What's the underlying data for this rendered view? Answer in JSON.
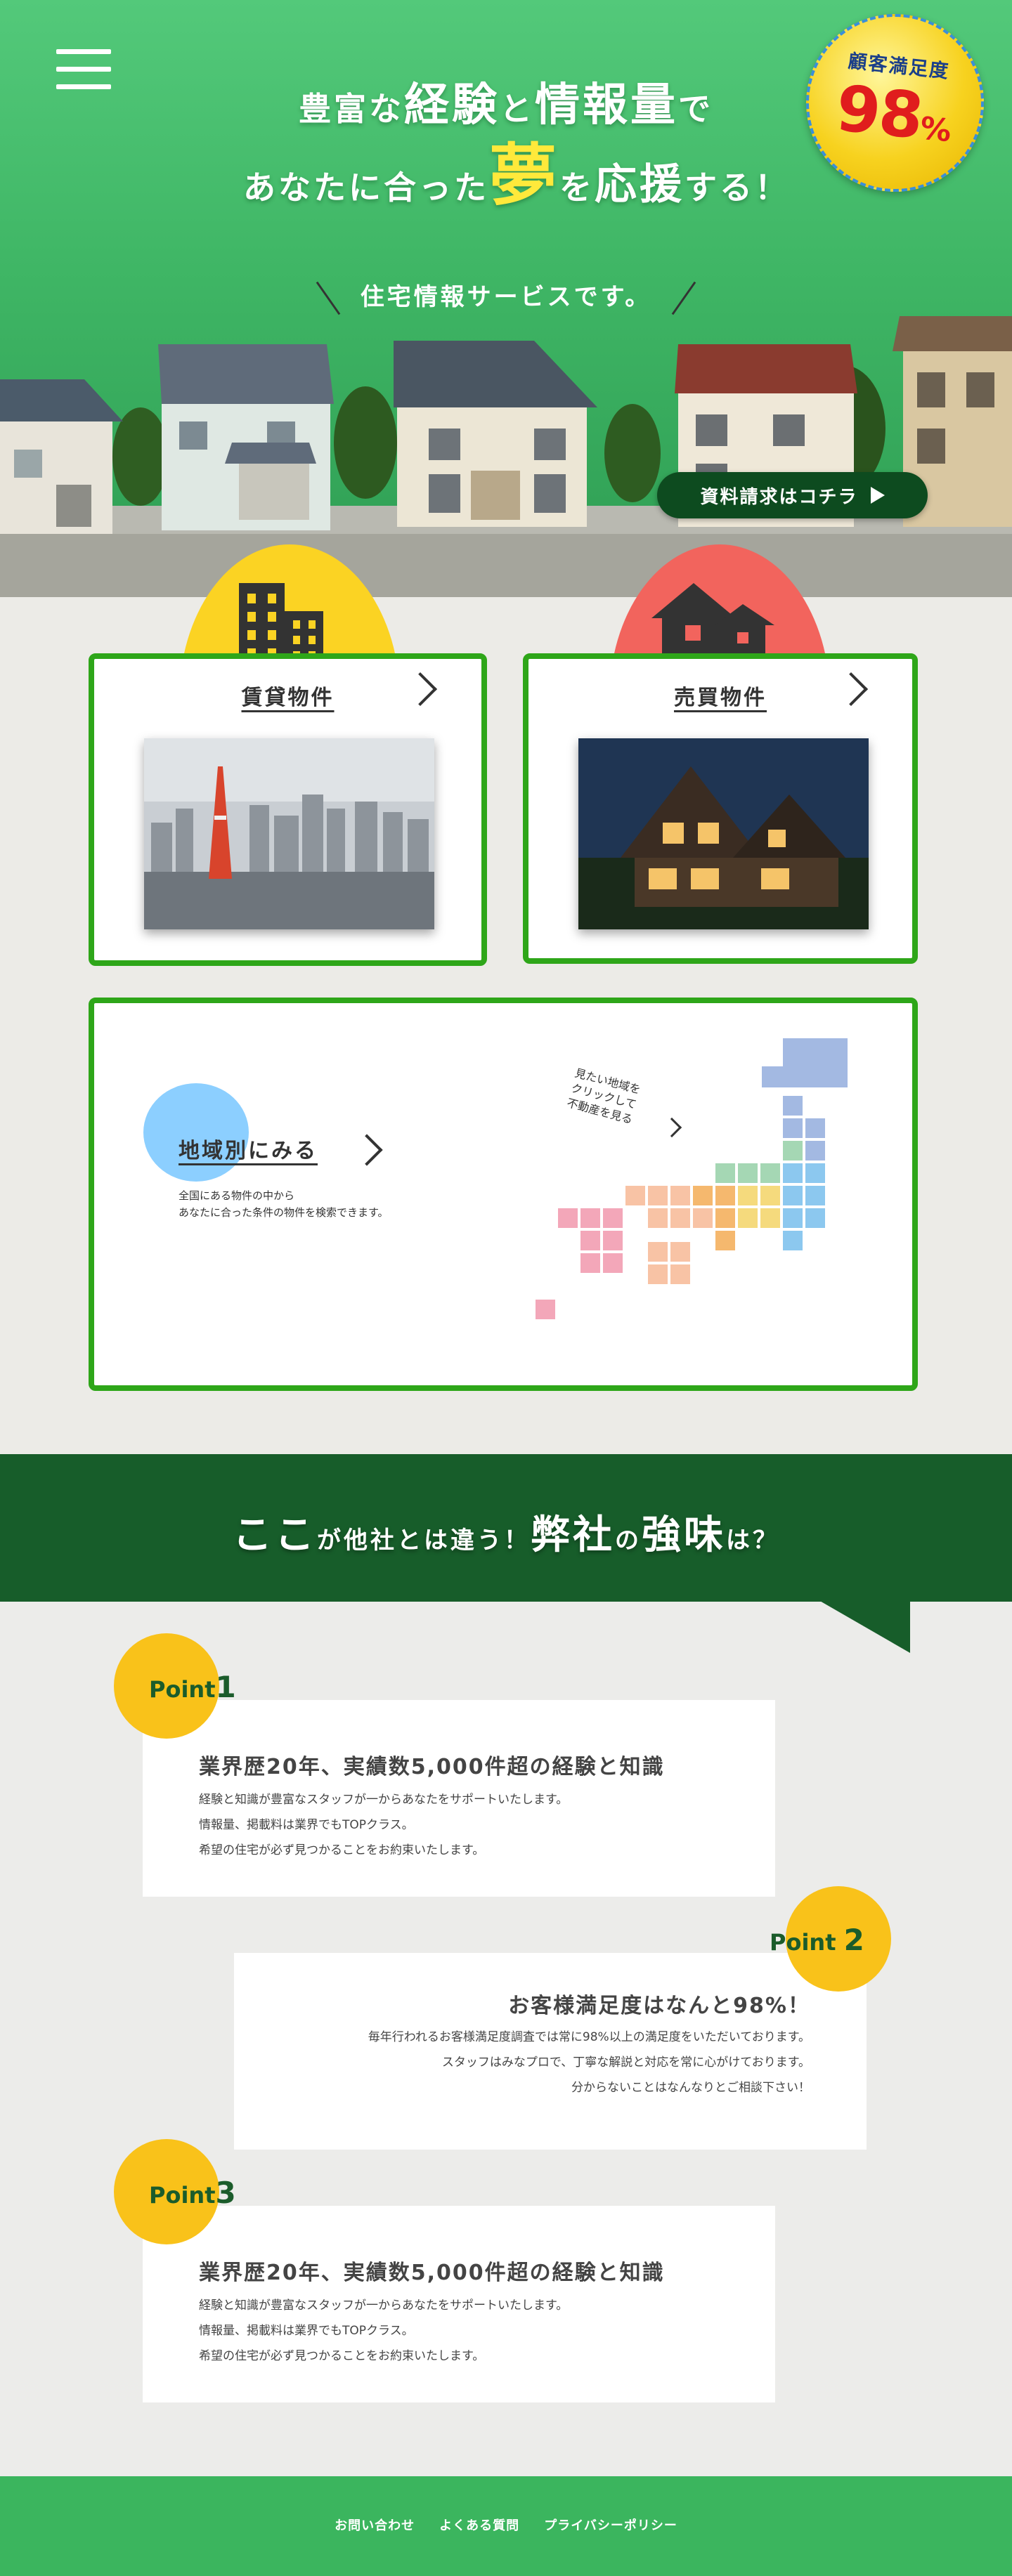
{
  "hero": {
    "headline1_a": "豊富な",
    "headline1_b": "経験",
    "headline1_c": "と",
    "headline1_d": "情報量",
    "headline1_e": "で",
    "headline2_a": "あなたに合った",
    "headline2_b": "夢",
    "headline2_c": "を",
    "headline2_d": "応援",
    "headline2_e": "する！",
    "badge_label": "顧客満足度",
    "badge_value": "98",
    "badge_unit": "%",
    "tagline": "住宅情報サービスです。",
    "cta_label": "資料請求はコチラ"
  },
  "property": {
    "rent_title": "賃貸物件",
    "sale_title": "売買物件",
    "area_title": "地域別にみる",
    "area_desc_line1": "全国にある物件の中から",
    "area_desc_line2": "あなたに合った条件の物件を検索できます。",
    "map_note_line1": "見たい地域を",
    "map_note_line2": "クリックして",
    "map_note_line3": "不動産を見る"
  },
  "strengths": {
    "heading_a": "ここ",
    "heading_b": "が他社とは違う！",
    "heading_c": "弊社",
    "heading_d": "の",
    "heading_e": "強味",
    "heading_f": "は？",
    "points": [
      {
        "label": "Point",
        "number": "1",
        "title": "業界歴20年、実績数5,000件超の経験と知識",
        "lines": [
          "経験と知識が豊富なスタッフが一からあなたをサポートいたします。",
          "情報量、掲載料は業界でもTOPクラス。",
          "希望の住宅が必ず見つかることをお約束いたします。"
        ]
      },
      {
        "label": "Point",
        "number": "2",
        "title": "お客様満足度はなんと98%！",
        "lines": [
          "毎年行われるお客様満足度調査では常に98%以上の満足度をいただいております。",
          "スタッフはみなプロで、丁寧な解説と対応を常に心がけております。",
          "分からないことはなんなりとご相談下さい！"
        ]
      },
      {
        "label": "Point",
        "number": "3",
        "title": "業界歴20年、実績数5,000件超の経験と知識",
        "lines": [
          "経験と知識が豊富なスタッフが一からあなたをサポートいたします。",
          "情報量、掲載料は業界でもTOPクラス。",
          "希望の住宅が必ず見つかることをお約束いたします。"
        ]
      }
    ]
  },
  "footer": {
    "links": [
      "お問い合わせ",
      "よくある質問",
      "プライバシーポリシー"
    ]
  },
  "colors": {
    "hero_green": "#3fb665",
    "card_border": "#2ea619",
    "strength_header": "#175d2a",
    "point_yellow": "#f9c21a",
    "footer_green": "#3bb55e",
    "dream_yellow": "#ffe93b"
  },
  "icons": [
    "menu-icon",
    "building-icon",
    "house-icon",
    "chevron-right-icon",
    "play-icon"
  ]
}
